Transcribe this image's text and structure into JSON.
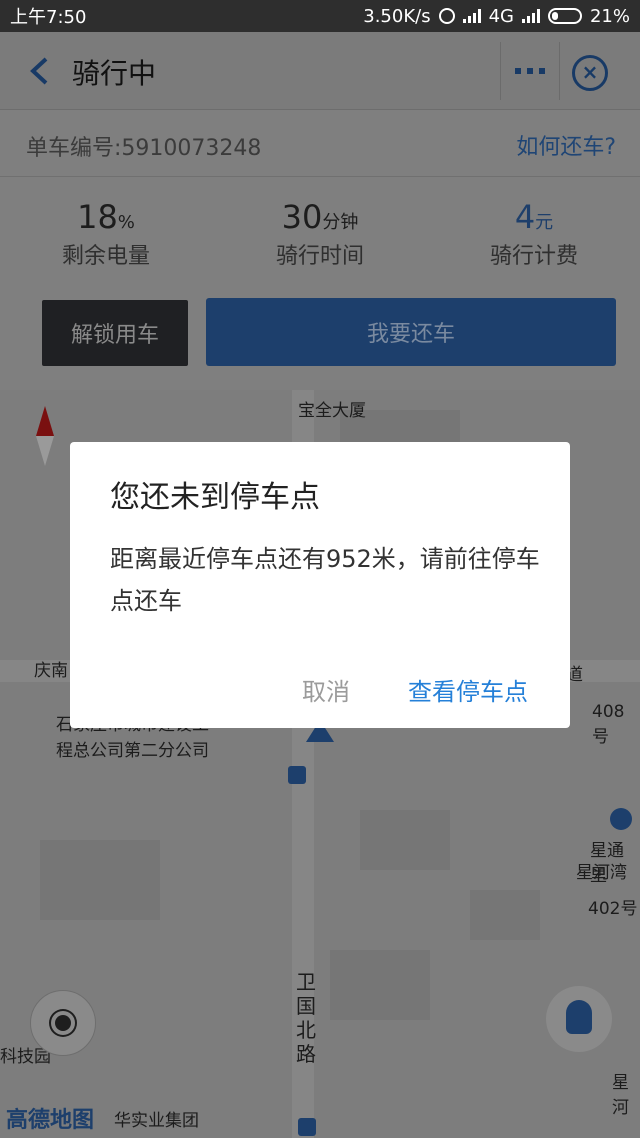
{
  "status_bar": {
    "time": "上午7:50",
    "net_speed": "3.50K/s",
    "network": "4G",
    "battery": "21%"
  },
  "header": {
    "title": "骑行中"
  },
  "bike": {
    "id_label": "单车编号:5910073248",
    "how_return": "如何还车?"
  },
  "stats": [
    {
      "value": "18",
      "unit": "%",
      "label": "剩余电量"
    },
    {
      "value": "30",
      "unit": "分钟",
      "label": "骑行时间"
    },
    {
      "value": "4",
      "unit": "元",
      "label": "骑行计费"
    }
  ],
  "buttons": {
    "unlock": "解锁用车",
    "return": "我要还车"
  },
  "map": {
    "labels": {
      "building": "宝全大厦",
      "road_west": "庆南",
      "company_1": "石家庄市城市建设工",
      "company_2": "程总公司第二分公司",
      "road_east": "道",
      "no408": "408号",
      "poi_1": "星通里",
      "poi_2": "星河湾",
      "no402": "402号",
      "street": "卫国北路",
      "tech_park": "科技园",
      "edge": "星河",
      "group": "华实业集团",
      "logo": "高德地图"
    }
  },
  "dialog": {
    "title": "您还未到停车点",
    "message": "距离最近停车点还有952米，请前往停车点还车",
    "cancel": "取消",
    "view": "查看停车点"
  },
  "colors": {
    "primary": "#2580d8",
    "dark_button": "#1f2023",
    "overlay": "#7f7f7f"
  }
}
